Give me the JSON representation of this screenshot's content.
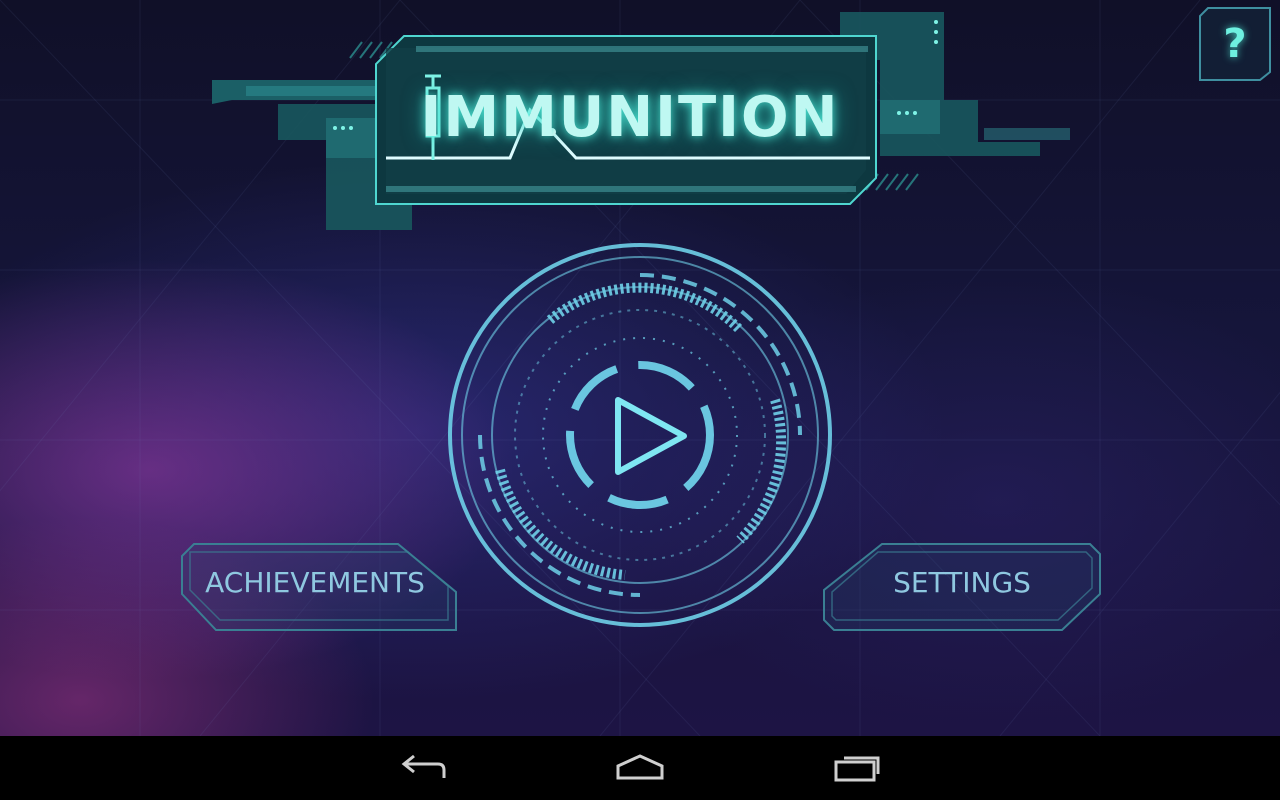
{
  "game": {
    "title": "IMMUNITION"
  },
  "help_button": {
    "label": "?"
  },
  "menu": {
    "achievements_label": "ACHIEVEMENTS",
    "settings_label": "SETTINGS"
  },
  "play_button": {
    "icon": "play-icon"
  },
  "navbar": {
    "back_icon": "back-arrow-icon",
    "home_icon": "home-icon",
    "recents_icon": "recent-apps-icon"
  },
  "colors": {
    "accent": "#4fd6d0",
    "panel": "#1f5c60",
    "button_outline": "#3a7f93",
    "button_text": "#8fc8e0",
    "dial_blue": "#6fd0e8"
  }
}
